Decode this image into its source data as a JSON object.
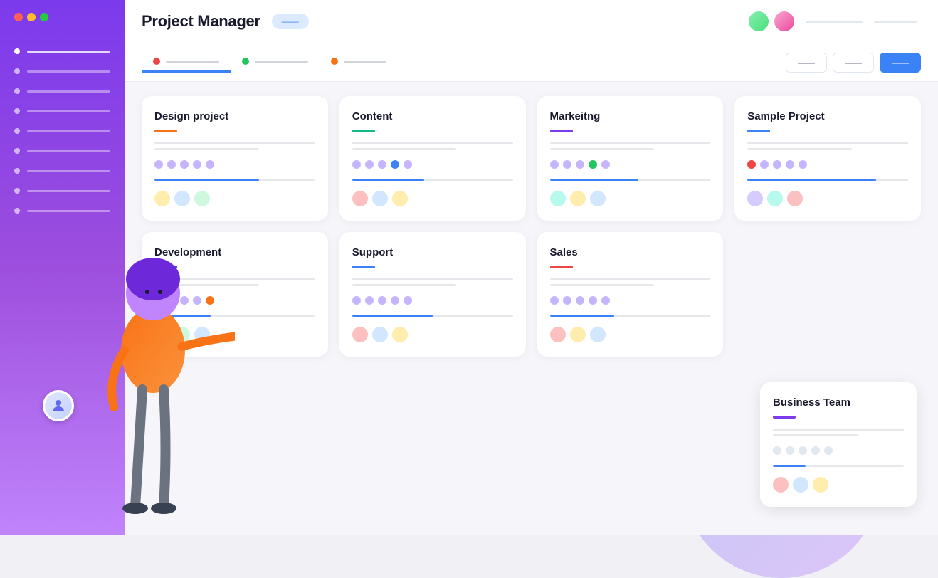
{
  "window": {
    "title": "Project Manager",
    "title_badge": "——",
    "dots": {
      "red": "#ff5f57",
      "yellow": "#febc2e",
      "green": "#28c840"
    }
  },
  "topbar": {
    "title": "Project Manager",
    "badge_label": "——",
    "avatar1_color": "#86efac",
    "avatar2_color": "#f9a8d4"
  },
  "filter_tabs": [
    {
      "label": "——",
      "dot_color": "#ef4444",
      "active": true
    },
    {
      "label": "——",
      "dot_color": "#22c55e",
      "active": false
    },
    {
      "label": "——",
      "dot_color": "#f97316",
      "active": false
    }
  ],
  "filter_buttons": [
    {
      "label": "——",
      "active": false
    },
    {
      "label": "——",
      "active": false
    },
    {
      "label": "——",
      "active": true
    }
  ],
  "projects": [
    {
      "title": "Design project",
      "accent_color": "#f97316",
      "members": [
        "#c4b5fd",
        "#c4b5fd",
        "#c4b5fd",
        "#c4b5fd",
        "#c4b5fd"
      ],
      "progress": 65,
      "avatars": [
        "#fde68a",
        "#bfdbfe",
        "#bbf7d0"
      ]
    },
    {
      "title": "Content",
      "accent_color": "#10b981",
      "members": [
        "#c4b5fd",
        "#c4b5fd",
        "#c4b5fd",
        "#3b82f6",
        "#c4b5fd"
      ],
      "progress": 45,
      "avatars": [
        "#fca5a5",
        "#bfdbfe",
        "#fde68a"
      ]
    },
    {
      "title": "Markeitng",
      "accent_color": "#7c3aed",
      "members": [
        "#c4b5fd",
        "#c4b5fd",
        "#c4b5fd",
        "#22c55e",
        "#c4b5fd"
      ],
      "progress": 55,
      "avatars": [
        "#99f6e4",
        "#fde68a",
        "#bfdbfe"
      ]
    },
    {
      "title": "Sample Project",
      "accent_color": "#3b82f6",
      "members": [
        "#ef4444",
        "#c4b5fd",
        "#c4b5fd",
        "#c4b5fd",
        "#c4b5fd"
      ],
      "progress": 80,
      "avatars": [
        "#c4b5fd",
        "#99f6e4",
        "#fca5a5"
      ]
    },
    {
      "title": "Development",
      "accent_color": "#3b4fd8",
      "members": [
        "#c4b5fd",
        "#c4b5fd",
        "#c4b5fd",
        "#c4b5fd",
        "#f97316"
      ],
      "progress": 35,
      "avatars": [
        "#fde68a",
        "#bbf7d0",
        "#bfdbfe"
      ]
    },
    {
      "title": "Support",
      "accent_color": "#3b82f6",
      "members": [
        "#c4b5fd",
        "#c4b5fd",
        "#c4b5fd",
        "#c4b5fd",
        "#c4b5fd"
      ],
      "progress": 50,
      "avatars": [
        "#fca5a5",
        "#bfdbfe",
        "#fde68a"
      ]
    },
    {
      "title": "Sales",
      "accent_color": "#ef4444",
      "members": [
        "#c4b5fd",
        "#c4b5fd",
        "#c4b5fd",
        "#c4b5fd",
        "#c4b5fd"
      ],
      "progress": 40,
      "avatars": [
        "#fca5a5",
        "#fde68a",
        "#bfdbfe"
      ]
    }
  ],
  "business_team": {
    "title": "Business Team",
    "accent_color": "#7c3aed",
    "members": [
      "#c4b5fd",
      "#c4b5fd",
      "#c4b5fd",
      "#c4b5fd",
      "#c4b5fd"
    ],
    "progress": 25,
    "avatars": [
      "#fca5a5",
      "#bfdbfe",
      "#fde68a"
    ]
  },
  "sidebar": {
    "items": [
      {
        "active": true
      },
      {
        "active": false
      },
      {
        "active": false
      },
      {
        "active": false
      },
      {
        "active": false
      },
      {
        "active": false
      },
      {
        "active": false
      },
      {
        "active": false
      },
      {
        "active": false
      }
    ]
  }
}
